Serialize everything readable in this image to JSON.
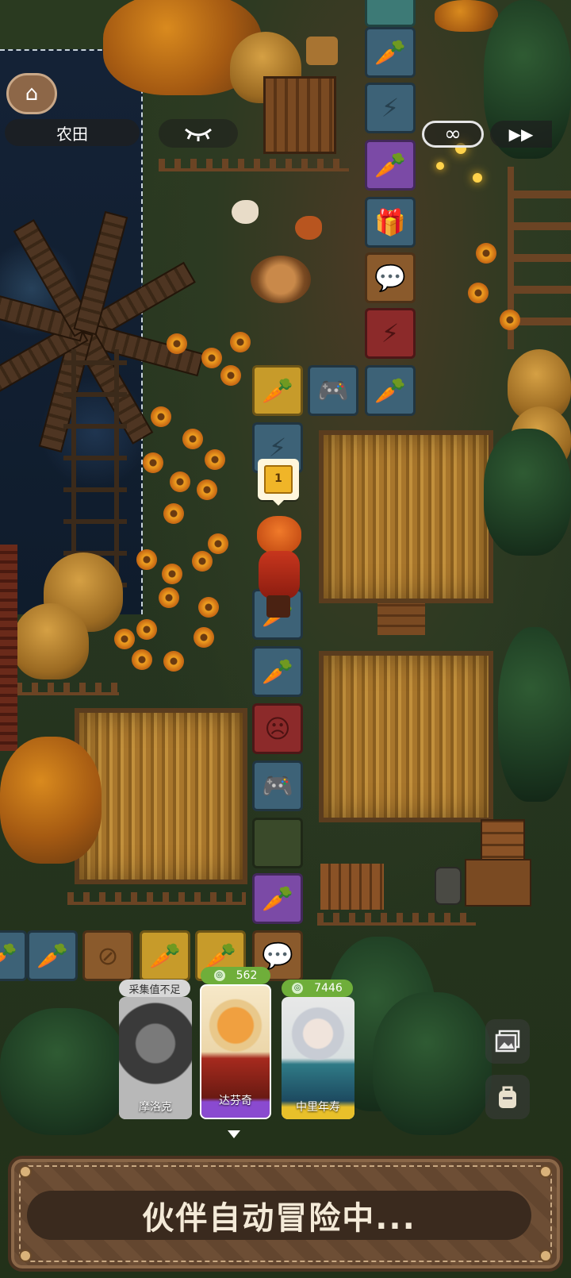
{
  "hud": {
    "home_icon": "home-icon",
    "area_label": "农田",
    "eye_icon": "eye-closed-icon",
    "loop_icon": "infinity-icon",
    "fast_forward_icon": "fast-forward-icon"
  },
  "board": {
    "tile_icons": [
      "carrot",
      "lightning",
      "carrot",
      "gift",
      "chat",
      "lightning-minus",
      "carrot",
      "gamepad",
      "carrot",
      "lightning",
      "carrot",
      "sad-face",
      "gamepad",
      "empty",
      "carrot",
      "chat",
      "no-sign",
      "carrot",
      "carrot"
    ],
    "player_bubble_number": "1"
  },
  "party": {
    "cards": [
      {
        "name": "摩洛克",
        "badge_text": "采集值不足",
        "selected": false,
        "disabled": true
      },
      {
        "name": "达芬奇",
        "badge_text": "562",
        "selected": true,
        "disabled": false
      },
      {
        "name": "中里年寿",
        "badge_text": "7446",
        "selected": false,
        "disabled": false
      }
    ]
  },
  "side_buttons": {
    "gallery_icon": "gallery-icon",
    "backpack_icon": "backpack-icon"
  },
  "status": {
    "message": "伙伴自动冒险中..."
  },
  "colors": {
    "panel_brown": "#6d4e35",
    "badge_green": "#6fae3a",
    "card_purple": "#8a4ad0"
  }
}
